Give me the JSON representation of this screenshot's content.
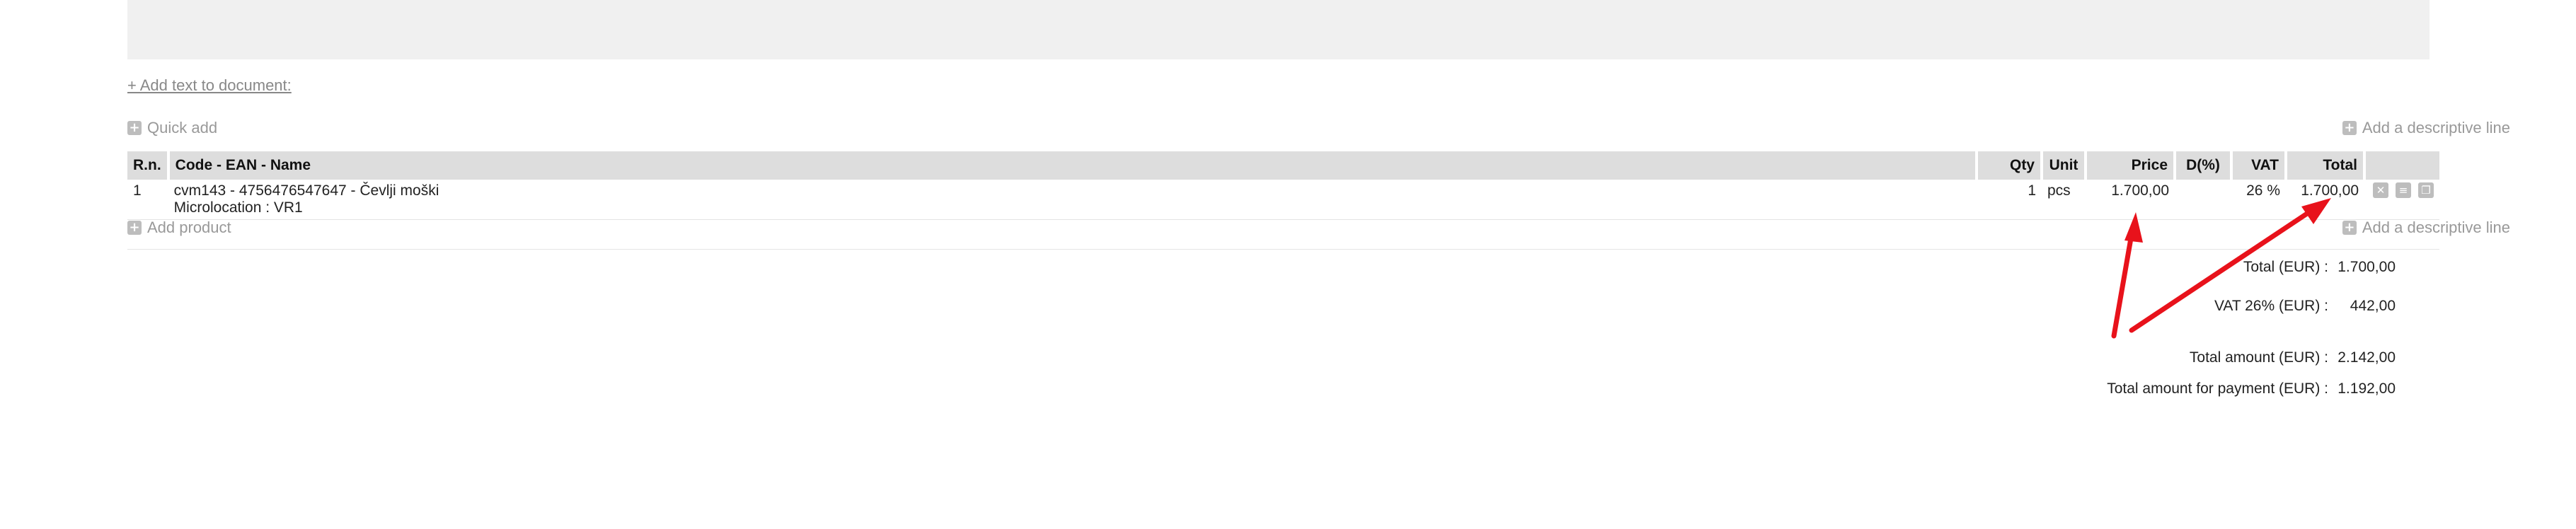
{
  "add_text_link": "+ Add text to document:",
  "quick_add": "Quick add",
  "add_descriptive_line": "Add a descriptive line",
  "add_product": "Add product",
  "table": {
    "headers": {
      "rn": "R.n.",
      "name": "Code - EAN - Name",
      "qty": "Qty",
      "unit": "Unit",
      "price": "Price",
      "discount": "D(%)",
      "vat": "VAT",
      "total": "Total"
    },
    "rows": [
      {
        "rn": "1",
        "name": "cvm143 - 4756476547647 - Čevlji moški",
        "sub": "Microlocation : VR1",
        "qty": "1",
        "unit": "pcs",
        "price": "1.700,00",
        "discount": "",
        "vat": "26 %",
        "total": "1.700,00"
      }
    ]
  },
  "totals": {
    "total_label": "Total (EUR) :",
    "total_value": "1.700,00",
    "vat_label": "VAT 26% (EUR) :",
    "vat_value": "442,00",
    "amount_label": "Total amount (EUR) :",
    "amount_value": "2.142,00",
    "payment_label": "Total amount for payment (EUR) :",
    "payment_value": "1.192,00"
  },
  "colors": {
    "annotation_arrow": "#e8121b",
    "header_bg": "#dddddd",
    "icon_gray": "#bdbdbd"
  },
  "icons": [
    "plus-icon",
    "delete-icon",
    "move-icon",
    "copy-icon"
  ]
}
